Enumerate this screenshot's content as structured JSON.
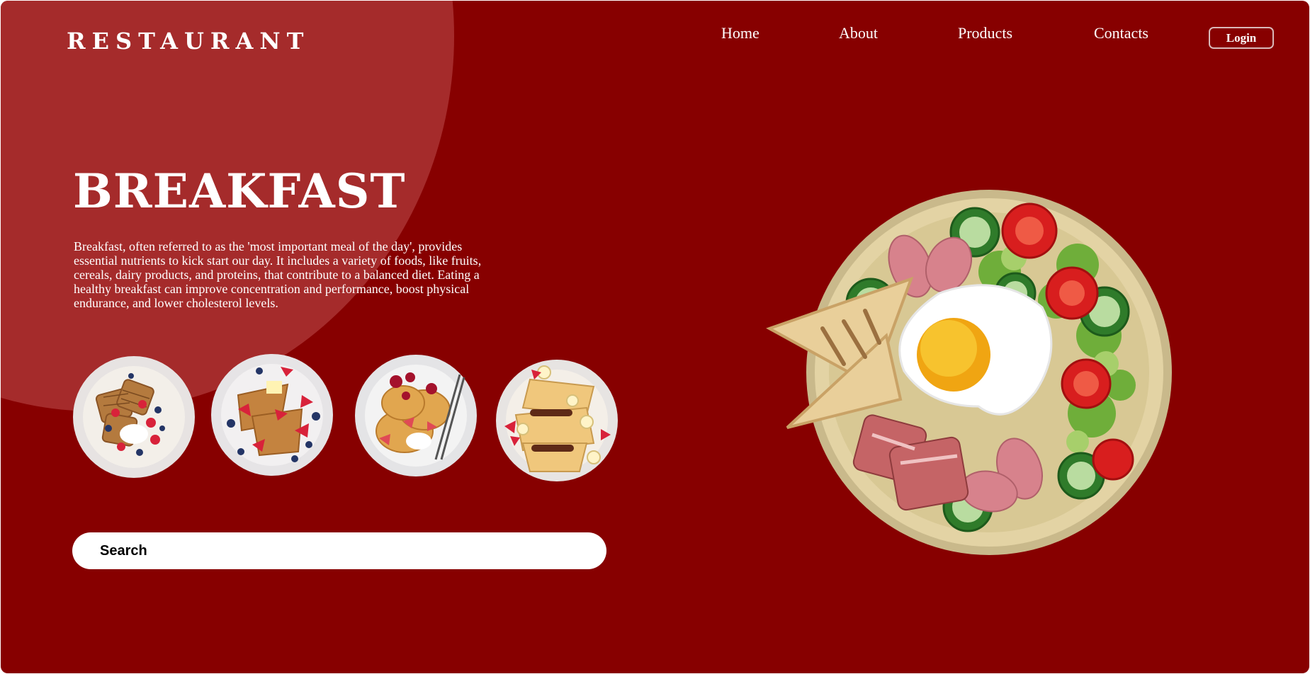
{
  "header": {
    "logo": "RESTAURANT",
    "nav": [
      "Home",
      "About",
      "Products",
      "Contacts"
    ],
    "login_label": "Login"
  },
  "hero": {
    "title": "BREAKFAST",
    "description": "Breakfast, often referred to as the 'most important meal of the day', provides essential nutrients to kick start our day. It includes a variety of foods, like fruits, cereals, dairy products, and proteins, that contribute to a balanced diet. Eating a healthy breakfast can improve concentration and performance, boost physical endurance, and lower cholesterol levels."
  },
  "dishes": [
    "waffles-plate",
    "french-toast-plate",
    "pancakes-plate",
    "crepes-plate"
  ],
  "search": {
    "placeholder": "Search"
  },
  "colors": {
    "background": "#870000",
    "accent_circle": "#a52b2b",
    "text": "#ffffff"
  },
  "icons": [
    "breakfast-plate-image"
  ]
}
